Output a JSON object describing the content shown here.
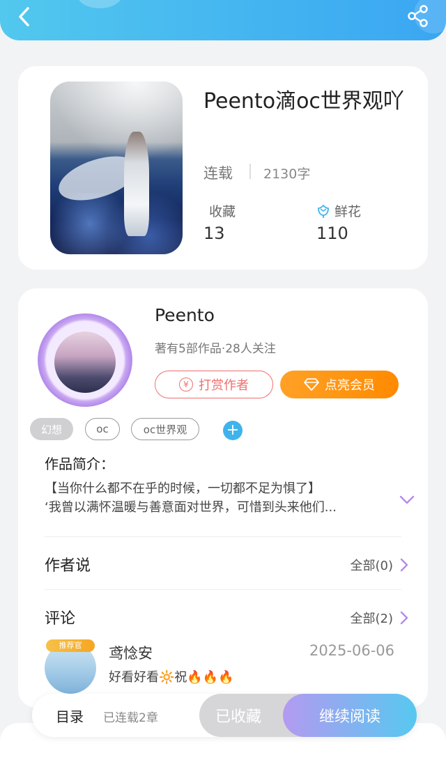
{
  "header": {
    "back_icon": "chevron-left-icon",
    "share_icon": "share-icon"
  },
  "book": {
    "title": "Peento滴oc世界观吖",
    "status": "连载",
    "word_count": "2130字",
    "favorites_label": "收藏",
    "favorites_value": "13",
    "flowers_label": "鲜花",
    "flowers_value": "110"
  },
  "author": {
    "name": "Peento",
    "meta": "著有5部作品·28人关注",
    "reward_label": "打赏作者",
    "vip_label": "点亮会员"
  },
  "tags": [
    "幻想",
    "oc",
    "oc世界观"
  ],
  "intro": {
    "label": "作品简介：",
    "line1": "【当你什么都不在乎的时候，一切都不足为惧了】",
    "line2": "‘我曾以满怀温暖与善意面对世界，可惜到头来他们..."
  },
  "author_says": {
    "label": "作者说",
    "link": "全部(0)"
  },
  "comments": {
    "label": "评论",
    "link": "全部(2)",
    "items": [
      {
        "badge": "推荐官",
        "name": "鸢惗安",
        "date": "2025-06-06",
        "text": "好看好看🔆祝🔥🔥🔥"
      }
    ]
  },
  "bottom": {
    "toc_label": "目录",
    "toc_meta": "已连载2章",
    "collected_label": "已收藏",
    "continue_label": "继续阅读"
  },
  "colors": {
    "accent_blue": "#3aa6f2",
    "reward_red": "#f06f6f",
    "vip_orange": "#ff8a00",
    "tag_add_blue": "#3fb3ec",
    "expand_purple": "#b58be8"
  }
}
